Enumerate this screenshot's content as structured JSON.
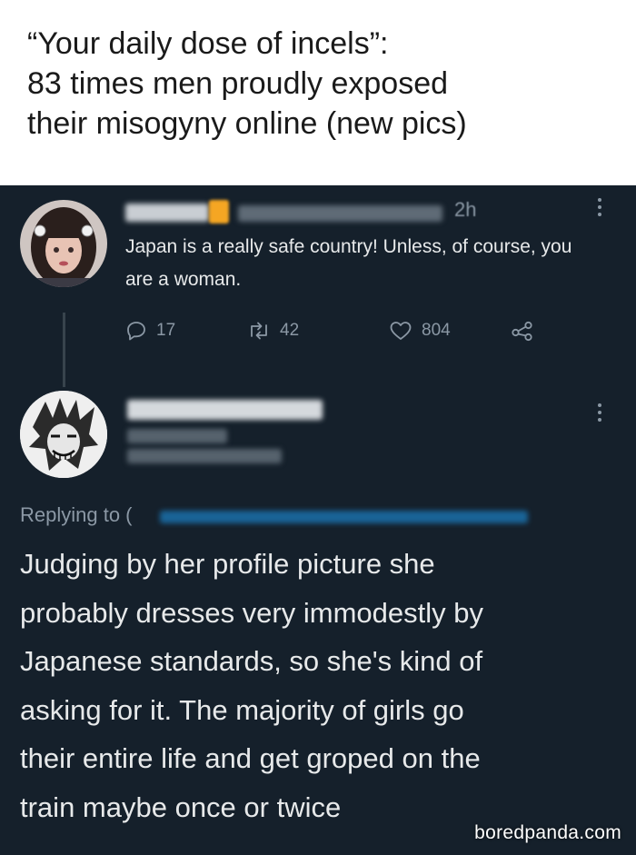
{
  "header": {
    "title_lines": [
      "“Your daily dose of incels”:",
      "83 times men proudly exposed",
      "their misogyny online (new pics)"
    ]
  },
  "tweet": {
    "time": "2h",
    "text": "Japan is a really safe country! Unless, of course, you are a woman.",
    "reply_count": "17",
    "retweet_count": "42",
    "like_count": "804"
  },
  "reply": {
    "replying_to_label": "Replying to (",
    "lines": [
      "Judging by her profile picture she",
      "probably dresses very immodestly by",
      "Japanese standards, so she's kind of",
      "asking for it. The majority of girls go",
      "their entire life and get groped on the",
      "train maybe once or twice"
    ]
  },
  "watermark": "boredpanda.com",
  "colors": {
    "background": "#15202b",
    "text": "#e7e9ea",
    "muted": "#8b98a5",
    "link_blue": "#1d9bf0",
    "accent_orange": "#f5a623"
  },
  "icons": [
    "reply-icon",
    "retweet-icon",
    "heart-icon",
    "share-icon",
    "more-icon"
  ]
}
